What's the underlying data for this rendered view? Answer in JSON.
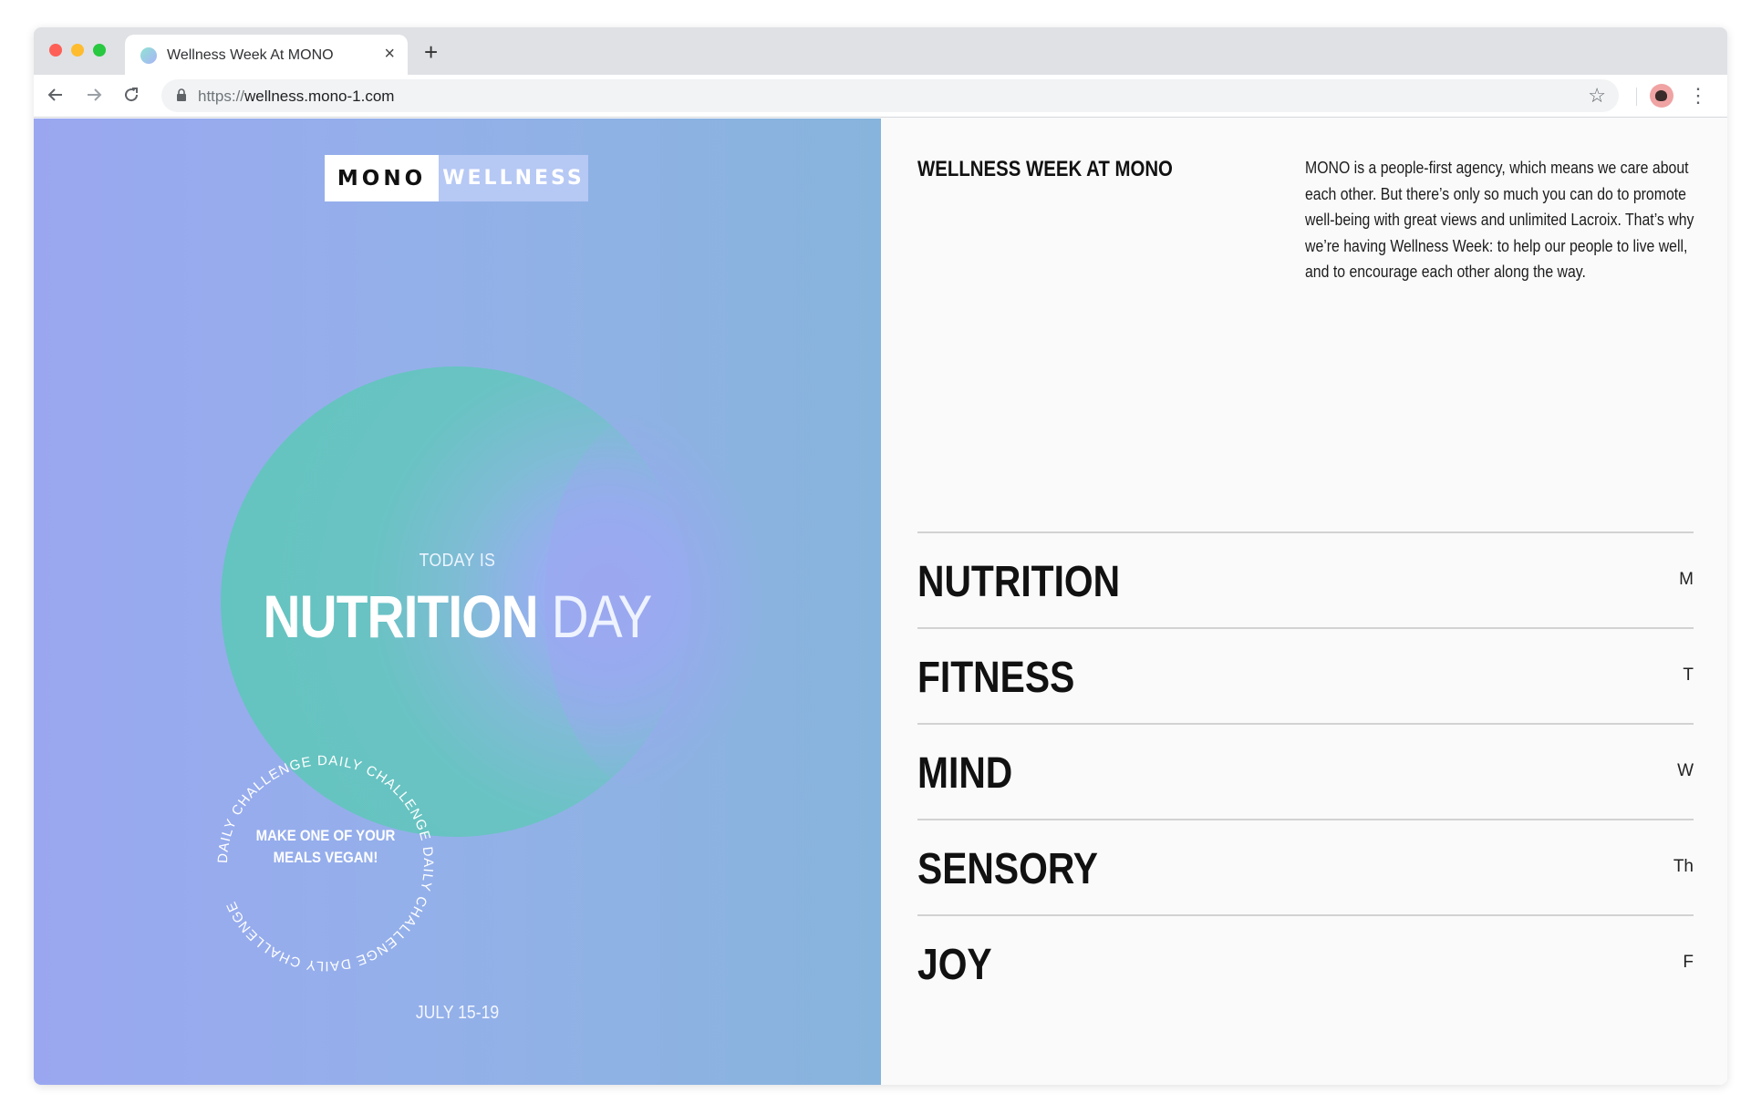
{
  "browser": {
    "tab_title": "Wellness Week At MONO",
    "tab_close": "×",
    "new_tab": "+",
    "url_scheme": "https://",
    "url_host": "wellness.mono-1.com"
  },
  "hero": {
    "brand_primary": "MONO",
    "brand_secondary": "WELLNESS",
    "eyebrow": "TODAY IS",
    "headline_bold": "NUTRITION",
    "headline_light": "DAY",
    "challenge_ring_text": "DAILY CHALLENGE DAILY CHALLENGE DAILY CHALLENGE DAILY CHALLENGE ",
    "challenge_line1": "MAKE ONE OF YOUR",
    "challenge_line2": "MEALS VEGAN!",
    "dates": "JULY 15-19"
  },
  "info": {
    "title": "WELLNESS WEEK AT MONO",
    "body": "MONO is a people-first agency, which means we care about each other. But there’s only so much you can do to promote well-being with great views and unlimited Lacroix. That’s why we’re having Wellness Week: to help our people to live well, and to encourage each other along the way."
  },
  "days": [
    {
      "name": "NUTRITION",
      "abbr": "M"
    },
    {
      "name": "FITNESS",
      "abbr": "T"
    },
    {
      "name": "MIND",
      "abbr": "W"
    },
    {
      "name": "SENSORY",
      "abbr": "Th"
    },
    {
      "name": "JOY",
      "abbr": "F"
    }
  ],
  "colors": {
    "hero_left": "#9aa7f0",
    "hero_right": "#87b4dc",
    "blob_teal": "#62c4bd",
    "blob_lilac": "#a2a8f3",
    "brand_secondary_bg": "#b6c8f4"
  },
  "icons": {
    "back": "arrow-left-icon",
    "forward": "arrow-right-icon",
    "reload": "reload-icon",
    "lock": "lock-icon",
    "bookmark": "star-icon",
    "menu": "kebab-menu-icon"
  }
}
